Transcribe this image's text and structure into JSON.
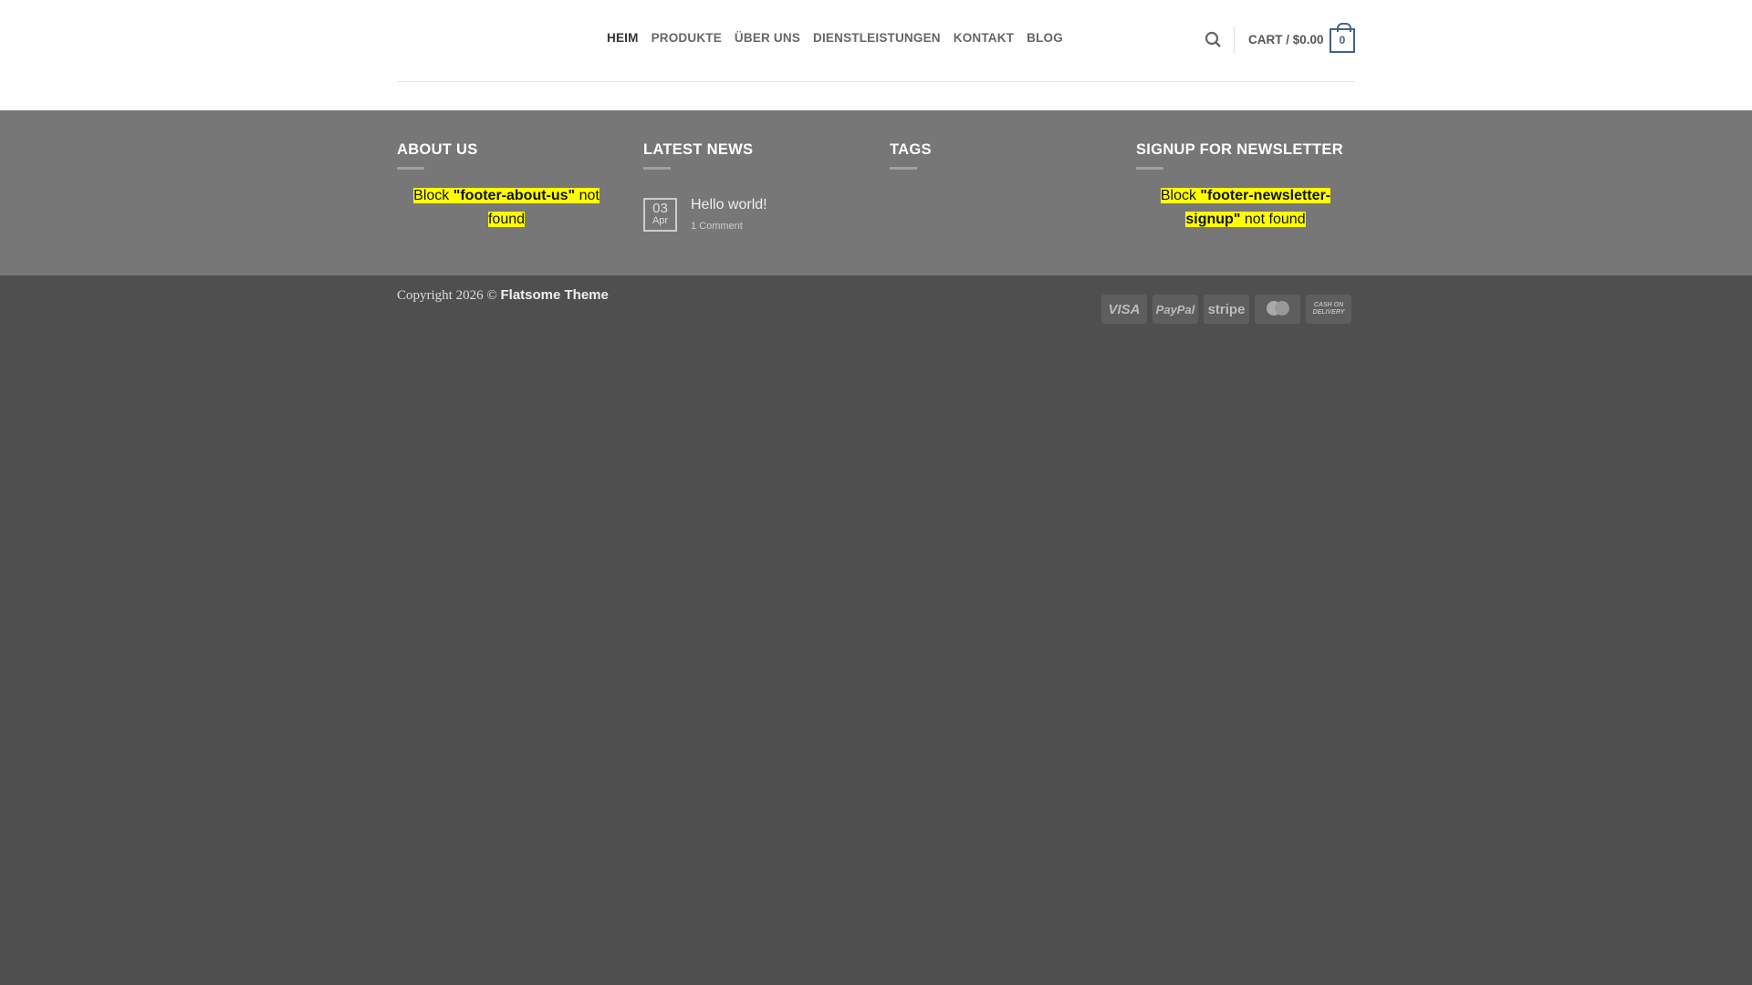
{
  "nav": {
    "items": [
      "HEIM",
      "PRODUKTE",
      "ÜBER UNS",
      "DIENSTLEISTUNGEN",
      "KONTAKT",
      "BLOG"
    ]
  },
  "cart": {
    "label": "CART / $0.00",
    "count": "0"
  },
  "footer": {
    "about": {
      "title": "ABOUT US",
      "msg_pre": "Block ",
      "msg_key": "\"footer-about-us\"",
      "msg_post": " not found"
    },
    "news": {
      "title": "LATEST NEWS",
      "day": "03",
      "month": "Apr",
      "post_title": "Hello world!",
      "comments": "1 Comment"
    },
    "tags": {
      "title": "TAGS"
    },
    "newsletter": {
      "title": "SIGNUP FOR NEWSLETTER",
      "msg_pre": "Block ",
      "msg_key": "\"footer-newsletter-signup\"",
      "msg_post": " not found"
    }
  },
  "bottom": {
    "copyright": "Copyright 2026 © ",
    "brand": "Flatsome Theme",
    "payments": [
      "VISA",
      "PayPal",
      "stripe",
      "mastercard",
      "CASH ON DELIVERY"
    ]
  }
}
